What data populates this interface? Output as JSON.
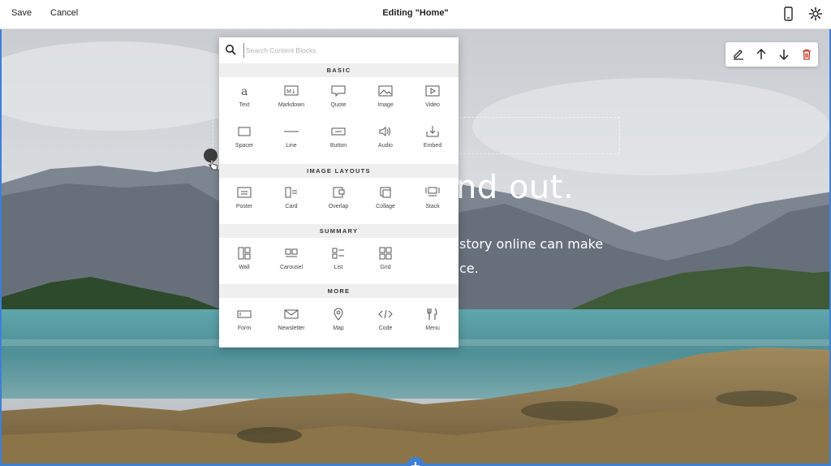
{
  "topbar": {
    "save_label": "Save",
    "cancel_label": "Cancel",
    "title": "Editing \"Home\""
  },
  "hero": {
    "heading": "nd out.",
    "body_line1": "story online can make",
    "body_line2": "ce."
  },
  "picker": {
    "search_placeholder": "Search Content Blocks",
    "sections": {
      "basic": "BASIC",
      "image_layouts": "IMAGE LAYOUTS",
      "summary": "SUMMARY",
      "more": "MORE"
    },
    "basic": [
      "Text",
      "Markdown",
      "Quote",
      "Image",
      "Video",
      "Spacer",
      "Line",
      "Button",
      "Audio",
      "Embed"
    ],
    "image_layouts": [
      "Poster",
      "Card",
      "Overlap",
      "Collage",
      "Stack"
    ],
    "summary": [
      "Wall",
      "Carousel",
      "List",
      "Grid"
    ],
    "more": [
      "Form",
      "Newsletter",
      "Map",
      "Code",
      "Menu"
    ]
  },
  "colors": {
    "accent": "#3e7fd8",
    "delete": "#c0392b",
    "lake": "#4f8f96"
  },
  "icons": {
    "top_right": [
      "phone-icon",
      "gear-icon"
    ],
    "block_toolbar": [
      "pencil-icon",
      "arrow-up-icon",
      "arrow-down-icon",
      "trash-icon"
    ]
  }
}
